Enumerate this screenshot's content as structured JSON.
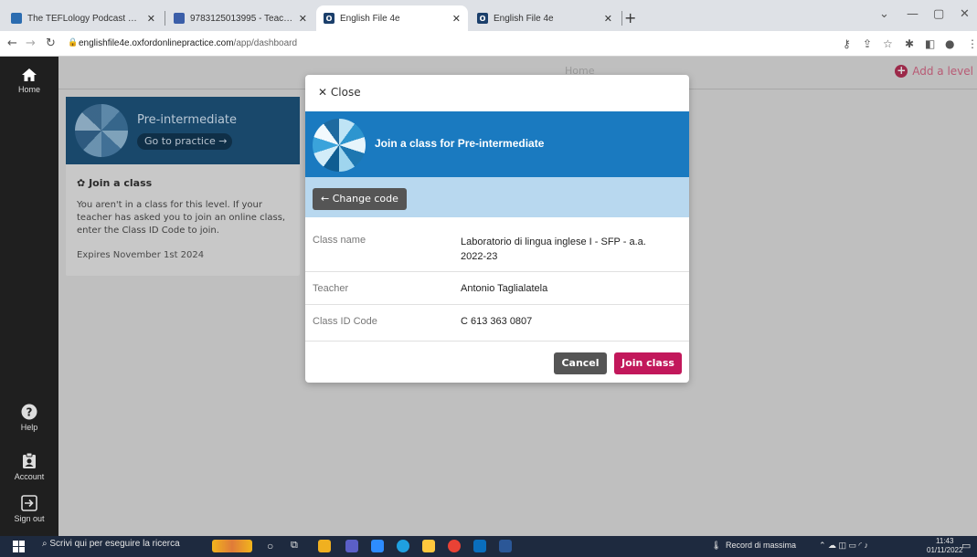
{
  "browser": {
    "tabs": [
      {
        "label": "The TEFLology Podcast – A Podc",
        "favicon_color": "#2b6cb0",
        "active": false
      },
      {
        "label": "9783125013995 - Teaching Engli",
        "favicon_color": "#3b5ea8",
        "active": false
      },
      {
        "label": "English File 4e",
        "favicon_color": "#1b3f6b",
        "favicon_glyph": "O",
        "active": true
      },
      {
        "label": "English File 4e",
        "favicon_color": "#1b3f6b",
        "favicon_glyph": "O",
        "active": false
      }
    ],
    "new_tab_symbol": "+",
    "url_host": "englishfile4e.oxfordonlinepractice.com",
    "url_path": "/app/dashboard"
  },
  "sidebar": {
    "home_label": "Home",
    "help_label": "Help",
    "account_label": "Account",
    "signout_label": "Sign out"
  },
  "header": {
    "title": "Home",
    "add_level_label": "Add a level"
  },
  "level_card": {
    "title": "Pre-intermediate",
    "go_label": "Go to practice →",
    "join_heading": "Join a class",
    "join_text": "You aren't in a class for this level. If your teacher has asked you to join an online class, enter the Class ID Code to join.",
    "expires": "Expires November 1st 2024"
  },
  "modal": {
    "close_label": "Close",
    "title": "Join a class for Pre-intermediate",
    "change_code_label": "Change code",
    "rows": [
      {
        "label": "Class name",
        "value": "Laboratorio di lingua inglese I - SFP - a.a. 2022-23"
      },
      {
        "label": "Teacher",
        "value": "Antonio Taglialatela"
      },
      {
        "label": "Class ID Code",
        "value": "C 613 363 0807"
      }
    ],
    "cancel_label": "Cancel",
    "join_label": "Join class",
    "colors": {
      "header": "#1a7ac0",
      "band": "#b8d8ef",
      "join": "#c2185b",
      "cancel": "#555555"
    }
  },
  "taskbar": {
    "search_placeholder": "Scrivi qui per eseguire la ricerca",
    "weather_text": "Record di massima",
    "time": "11:43",
    "date": "01/11/2022"
  }
}
